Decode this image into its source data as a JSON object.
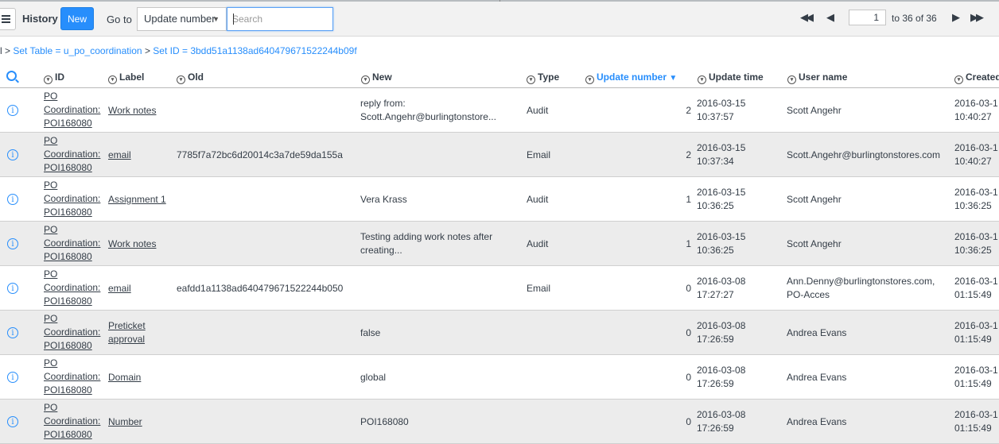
{
  "header": {
    "title": "History",
    "new_label": "New",
    "goto_label": "Go to",
    "field_select": "Update number",
    "search_placeholder": "Search",
    "pager": {
      "page": "1",
      "range_text": "to 36 of 36"
    }
  },
  "breadcrumb": {
    "prefix": "l",
    "items": [
      "Set Table = u_po_coordination",
      "Set ID = 3bdd51a1138ad640479671522244b09f"
    ]
  },
  "columns": {
    "id": "ID",
    "label": "Label",
    "old": "Old",
    "new": "New",
    "type": "Type",
    "update_number": "Update number",
    "update_time": "Update time",
    "user_name": "User name",
    "created": "Created"
  },
  "rows": [
    {
      "id": [
        "PO",
        "Coordination:",
        "POI168080"
      ],
      "label": [
        "Work notes"
      ],
      "old": "",
      "new": [
        "reply from:",
        "Scott.Angehr@burlingtonstore..."
      ],
      "type": "Audit",
      "update_number": "2",
      "update_time": [
        "2016-03-15",
        "10:37:57"
      ],
      "user_name": [
        "Scott Angehr"
      ],
      "created": [
        "2016-03-1",
        "10:40:27"
      ]
    },
    {
      "id": [
        "PO",
        "Coordination:",
        "POI168080"
      ],
      "label": [
        "email"
      ],
      "old": "7785f7a72bc6d20014c3a7de59da155a",
      "new": [],
      "type": "Email",
      "update_number": "2",
      "update_time": [
        "2016-03-15",
        "10:37:34"
      ],
      "user_name": [
        "Scott.Angehr@burlingtonstores.com"
      ],
      "created": [
        "2016-03-1",
        "10:40:27"
      ]
    },
    {
      "id": [
        "PO",
        "Coordination:",
        "POI168080"
      ],
      "label": [
        "Assignment 1"
      ],
      "old": "",
      "new": [
        "Vera Krass"
      ],
      "type": "Audit",
      "update_number": "1",
      "update_time": [
        "2016-03-15",
        "10:36:25"
      ],
      "user_name": [
        "Scott Angehr"
      ],
      "created": [
        "2016-03-1",
        "10:36:25"
      ]
    },
    {
      "id": [
        "PO",
        "Coordination:",
        "POI168080"
      ],
      "label": [
        "Work notes"
      ],
      "old": "",
      "new": [
        "Testing adding work notes after",
        "creating..."
      ],
      "type": "Audit",
      "update_number": "1",
      "update_time": [
        "2016-03-15",
        "10:36:25"
      ],
      "user_name": [
        "Scott Angehr"
      ],
      "created": [
        "2016-03-1",
        "10:36:25"
      ]
    },
    {
      "id": [
        "PO",
        "Coordination:",
        "POI168080"
      ],
      "label": [
        "email"
      ],
      "old": "eafdd1a1138ad640479671522244b050",
      "new": [],
      "type": "Email",
      "update_number": "0",
      "update_time": [
        "2016-03-08",
        "17:27:27"
      ],
      "user_name": [
        "Ann.Denny@burlingtonstores.com,",
        "PO-Acces"
      ],
      "created": [
        "2016-03-1",
        "01:15:49"
      ]
    },
    {
      "id": [
        "PO",
        "Coordination:",
        "POI168080"
      ],
      "label": [
        "Preticket",
        "approval"
      ],
      "old": "",
      "new": [
        "false"
      ],
      "type": "",
      "update_number": "0",
      "update_time": [
        "2016-03-08",
        "17:26:59"
      ],
      "user_name": [
        "Andrea Evans"
      ],
      "created": [
        "2016-03-1",
        "01:15:49"
      ]
    },
    {
      "id": [
        "PO",
        "Coordination:",
        "POI168080"
      ],
      "label": [
        "Domain"
      ],
      "old": "",
      "new": [
        "global"
      ],
      "type": "",
      "update_number": "0",
      "update_time": [
        "2016-03-08",
        "17:26:59"
      ],
      "user_name": [
        "Andrea Evans"
      ],
      "created": [
        "2016-03-1",
        "01:15:49"
      ]
    },
    {
      "id": [
        "PO",
        "Coordination:",
        "POI168080"
      ],
      "label": [
        "Number"
      ],
      "old": "",
      "new": [
        "POI168080"
      ],
      "type": "",
      "update_number": "0",
      "update_time": [
        "2016-03-08",
        "17:26:59"
      ],
      "user_name": [
        "Andrea Evans"
      ],
      "created": [
        "2016-03-1",
        "01:15:49"
      ]
    }
  ]
}
